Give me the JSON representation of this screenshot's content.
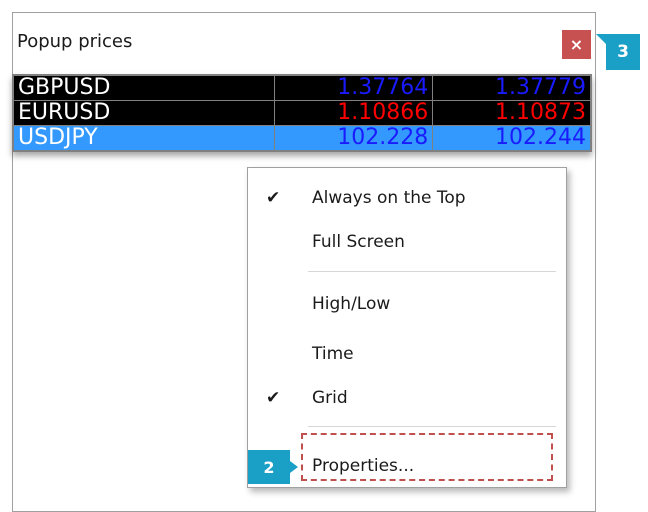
{
  "window": {
    "title": "Popup prices",
    "close_label": "×"
  },
  "prices": [
    {
      "symbol": "GBPUSD",
      "bid": "1.37764",
      "ask": "1.37779",
      "color": "#1a1aff",
      "selected": false
    },
    {
      "symbol": "EURUSD",
      "bid": "1.10866",
      "ask": "1.10873",
      "color": "#ff0000",
      "selected": false
    },
    {
      "symbol": "USDJPY",
      "bid": "102.228",
      "ask": "102.244",
      "color": "#1a1aff",
      "selected": true
    }
  ],
  "context_menu": {
    "items": [
      {
        "label": "Always on the Top",
        "checked": true
      },
      {
        "label": "Full Screen",
        "checked": false
      },
      {
        "label": "High/Low",
        "checked": false
      },
      {
        "label": "Time",
        "checked": false
      },
      {
        "label": "Grid",
        "checked": true
      },
      {
        "label": "Properties...",
        "checked": false
      }
    ],
    "check_glyph": "✔"
  },
  "callouts": {
    "close": "3",
    "properties": "2"
  },
  "colors": {
    "close_button": "#c75050",
    "callout": "#1aa0c7",
    "selection": "#3399ff",
    "highlight": "#c0504d"
  }
}
